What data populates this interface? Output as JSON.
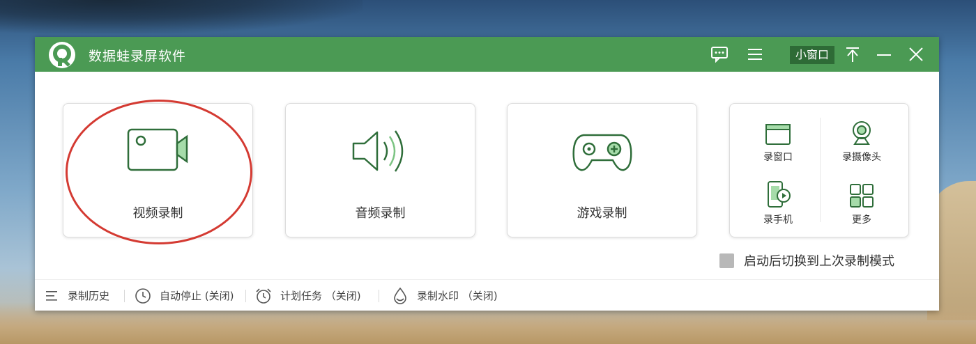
{
  "window": {
    "title": "数据蛙录屏软件",
    "small_window_label": "小窗口",
    "accent_color": "#4b9a54"
  },
  "titlebar_icons": [
    "chat-icon",
    "menu-icon",
    "pin-icon",
    "minimize-icon",
    "close-icon"
  ],
  "modes": [
    {
      "label": "视频录制",
      "icon": "video-camera-icon",
      "highlighted": true
    },
    {
      "label": "音频录制",
      "icon": "speaker-icon",
      "highlighted": false
    },
    {
      "label": "游戏录制",
      "icon": "gamepad-icon",
      "highlighted": false
    }
  ],
  "side_options": [
    {
      "label": "录窗口",
      "icon": "window-icon"
    },
    {
      "label": "录摄像头",
      "icon": "webcam-icon"
    },
    {
      "label": "录手机",
      "icon": "phone-icon"
    },
    {
      "label": "更多",
      "icon": "grid-icon"
    }
  ],
  "startup_option": {
    "label": "启动后切换到上次录制模式",
    "checked": false
  },
  "footer": {
    "items": [
      {
        "label": "录制历史",
        "icon": "list-icon"
      },
      {
        "label": "自动停止 (关闭)",
        "icon": "clock-icon"
      },
      {
        "label": "计划任务 （关闭)",
        "icon": "alarm-icon"
      },
      {
        "label": "录制水印 （关闭)",
        "icon": "watermark-icon"
      }
    ]
  }
}
